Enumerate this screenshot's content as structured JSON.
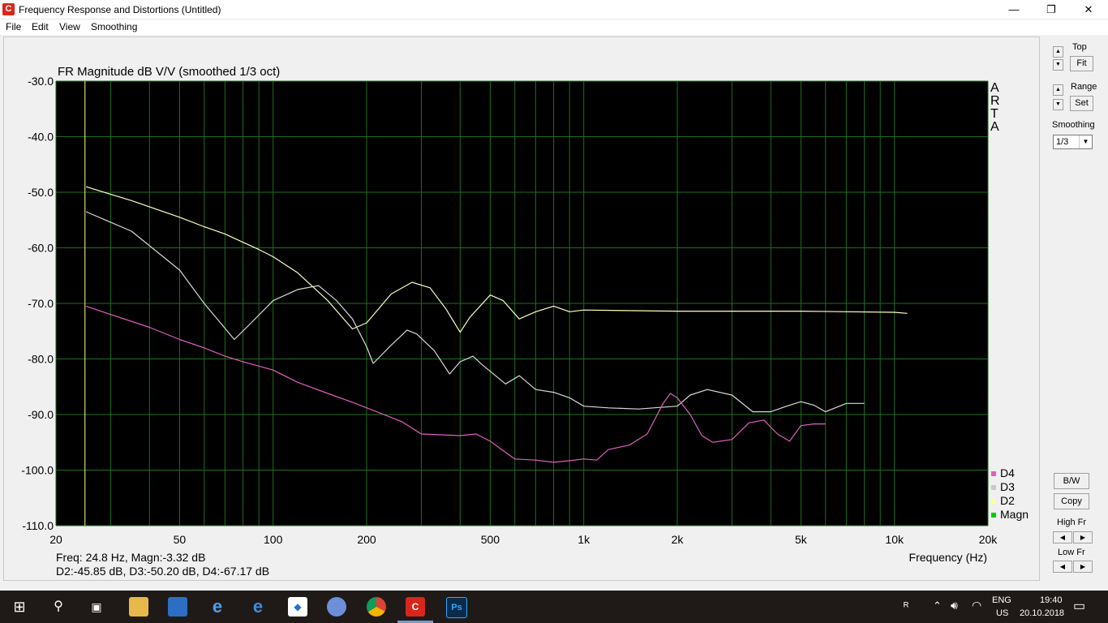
{
  "window": {
    "title": "Frequency Response and Distortions (Untitled)",
    "app_icon_glyph": "C",
    "minimize": "—",
    "maximize": "❐",
    "close": "✕"
  },
  "menu": [
    "File",
    "Edit",
    "View",
    "Smoothing"
  ],
  "chart_data": {
    "type": "line",
    "title": "FR Magnitude dB V/V (smoothed 1/3 oct)",
    "xlabel": "Frequency (Hz)",
    "ylabel": "",
    "x_scale": "log",
    "xlim": [
      20,
      20000
    ],
    "ylim": [
      -110,
      -30
    ],
    "x_ticks": [
      20,
      50,
      100,
      200,
      500,
      1000,
      2000,
      5000,
      10000,
      20000
    ],
    "x_tick_labels": [
      "20",
      "50",
      "100",
      "200",
      "500",
      "1k",
      "2k",
      "5k",
      "10k",
      "20k"
    ],
    "y_ticks": [
      -30,
      -40,
      -50,
      -60,
      -70,
      -80,
      -90,
      -100,
      -110
    ],
    "y_tick_labels": [
      "-30.0",
      "-40.0",
      "-50.0",
      "-60.0",
      "-70.0",
      "-80.0",
      "-90.0",
      "-100.0",
      "-110.0"
    ],
    "grid": true,
    "background": "#000000",
    "grid_color": "#1e6e1e",
    "cursor_x": 24.8,
    "side_label": [
      "A",
      "R",
      "T",
      "A"
    ],
    "legend": [
      {
        "name": "D4",
        "color": "#e060c0"
      },
      {
        "name": "D3",
        "color": "#c8c8c8"
      },
      {
        "name": "D2",
        "color": "#ffff90"
      },
      {
        "name": "Magn",
        "color": "#00d000"
      }
    ],
    "series": [
      {
        "name": "D2",
        "color": "#ffffc0",
        "x": [
          25,
          35,
          50,
          60,
          70,
          80,
          90,
          100,
          120,
          150,
          180,
          200,
          240,
          280,
          320,
          360,
          400,
          430,
          500,
          550,
          620,
          700,
          800,
          900,
          1000,
          2000,
          5000,
          10000,
          11000
        ],
        "y": [
          -49,
          -51.5,
          -54.5,
          -56.2,
          -57.5,
          -59,
          -60.3,
          -61.6,
          -64.5,
          -69.5,
          -74.6,
          -73.5,
          -68.3,
          -66.2,
          -67.2,
          -71,
          -75.2,
          -72.5,
          -68.5,
          -69.5,
          -72.8,
          -71.5,
          -70.5,
          -71.5,
          -71.2,
          -71.4,
          -71.4,
          -71.6,
          -71.8
        ]
      },
      {
        "name": "D3",
        "color": "#d8d8d8",
        "x": [
          25,
          35,
          50,
          60,
          70,
          75,
          85,
          100,
          120,
          140,
          160,
          180,
          200,
          210,
          240,
          270,
          290,
          330,
          370,
          400,
          440,
          470,
          560,
          620,
          700,
          800,
          900,
          1000,
          1200,
          1500,
          2000,
          2200,
          2500,
          3000,
          3500,
          4000,
          4500,
          5000,
          5500,
          6000,
          7000,
          8000
        ],
        "y": [
          -53.5,
          -57,
          -64,
          -70,
          -74.5,
          -76.5,
          -73.5,
          -69.5,
          -67.5,
          -66.8,
          -69.5,
          -72.8,
          -77.8,
          -80.8,
          -77.5,
          -74.8,
          -75.5,
          -78.5,
          -82.7,
          -80.5,
          -79.5,
          -81,
          -84.5,
          -83,
          -85.5,
          -86,
          -87,
          -88.5,
          -88.8,
          -89,
          -88.5,
          -86.5,
          -85.5,
          -86.5,
          -89.5,
          -89.5,
          -88.5,
          -87.7,
          -88.3,
          -89.5,
          -88,
          -88
        ]
      },
      {
        "name": "D4",
        "color": "#e060c0",
        "x": [
          25,
          30,
          40,
          50,
          60,
          70,
          80,
          100,
          120,
          150,
          180,
          220,
          260,
          300,
          400,
          450,
          500,
          550,
          600,
          700,
          800,
          900,
          1000,
          1100,
          1200,
          1400,
          1600,
          1800,
          1900,
          2000,
          2200,
          2400,
          2600,
          3000,
          3400,
          3800,
          4200,
          4600,
          5000,
          5500,
          6000
        ],
        "y": [
          -70.5,
          -72,
          -74.3,
          -76.5,
          -78,
          -79.5,
          -80.5,
          -82,
          -84.2,
          -86.2,
          -87.8,
          -89.7,
          -91.3,
          -93.5,
          -93.8,
          -93.5,
          -94.8,
          -96.5,
          -98,
          -98.2,
          -98.6,
          -98.3,
          -98,
          -98.2,
          -96.3,
          -95.5,
          -93.5,
          -88,
          -86.2,
          -87,
          -90,
          -93.8,
          -95,
          -94.5,
          -91.5,
          -91,
          -93.5,
          -94.8,
          -92,
          -91.7,
          -91.7
        ]
      }
    ]
  },
  "readout": {
    "freq": "Freq: 24.8 Hz, Magn:-3.32 dB",
    "dists": "D2:-45.85 dB, D3:-50.20 dB, D4:-67.17 dB"
  },
  "right_panel": {
    "top_label": "Top",
    "fit_label": "Fit",
    "range_label": "Range",
    "set_label": "Set",
    "smoothing_label": "Smoothing",
    "smoothing_value": "1/3",
    "bw_label": "B/W",
    "copy_label": "Copy",
    "high_fr_label": "High Fr",
    "low_fr_label": "Low Fr"
  },
  "taskbar": {
    "lang": "ENG",
    "layout": "US",
    "time": "19:40",
    "date": "20.10.2018",
    "ps_label": "Ps"
  }
}
